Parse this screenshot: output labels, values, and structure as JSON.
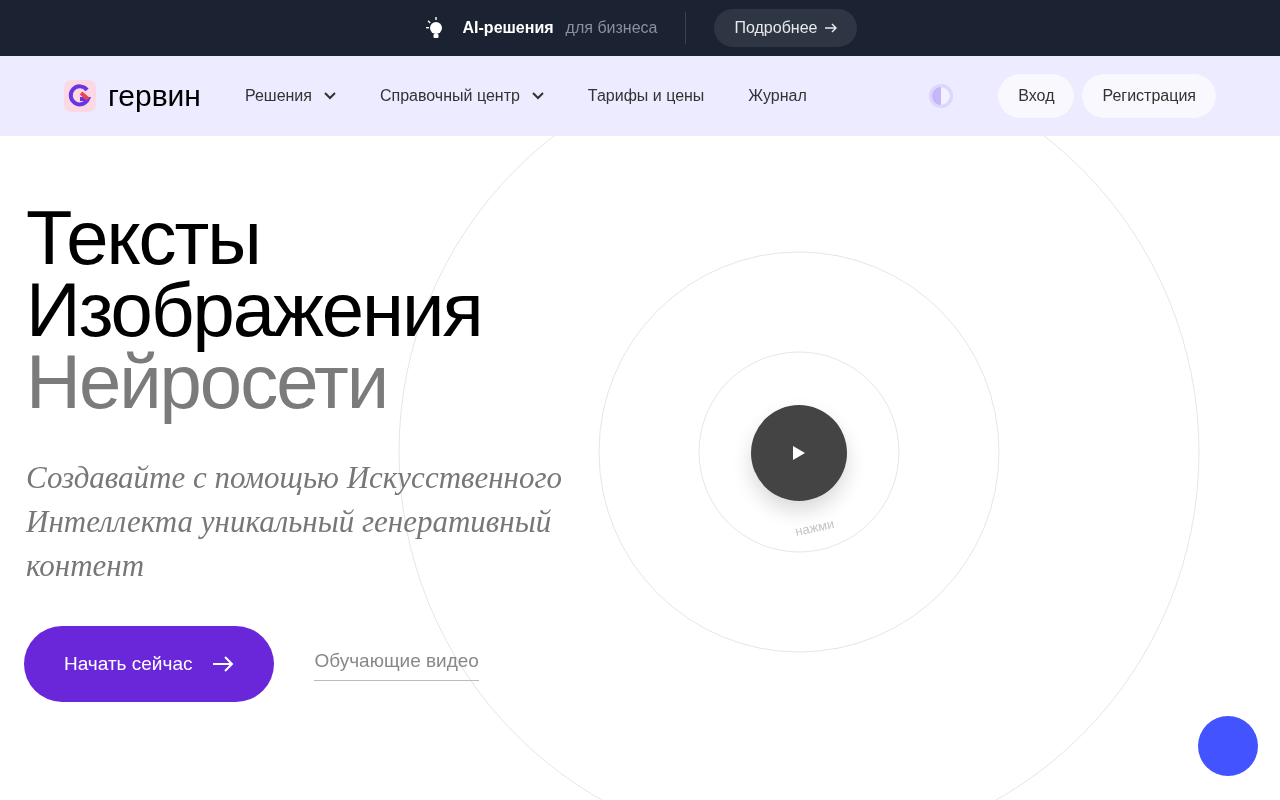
{
  "promo_bar": {
    "title": "AI-решения",
    "subtitle": "для бизнеса",
    "button": "Подробнее"
  },
  "nav": {
    "logo": "гервин",
    "items": [
      {
        "label": "Решения",
        "has_dropdown": true
      },
      {
        "label": "Справочный центр",
        "has_dropdown": true
      },
      {
        "label": "Тарифы и цены",
        "has_dropdown": false
      },
      {
        "label": "Журнал",
        "has_dropdown": false
      }
    ],
    "login": "Вход",
    "register": "Регистрация"
  },
  "hero": {
    "headline": [
      {
        "text": "Тексты",
        "kind": "primary"
      },
      {
        "text": "Изображения",
        "kind": "primary"
      },
      {
        "text": "Нейросети",
        "kind": "muted"
      }
    ],
    "subtitle": "Создавайте с помощью Искусственного Интеллекта уникальный генеративный контент",
    "cta": "Начать сейчас",
    "video_link": "Обучающие видео",
    "play_hint": "нажми"
  }
}
